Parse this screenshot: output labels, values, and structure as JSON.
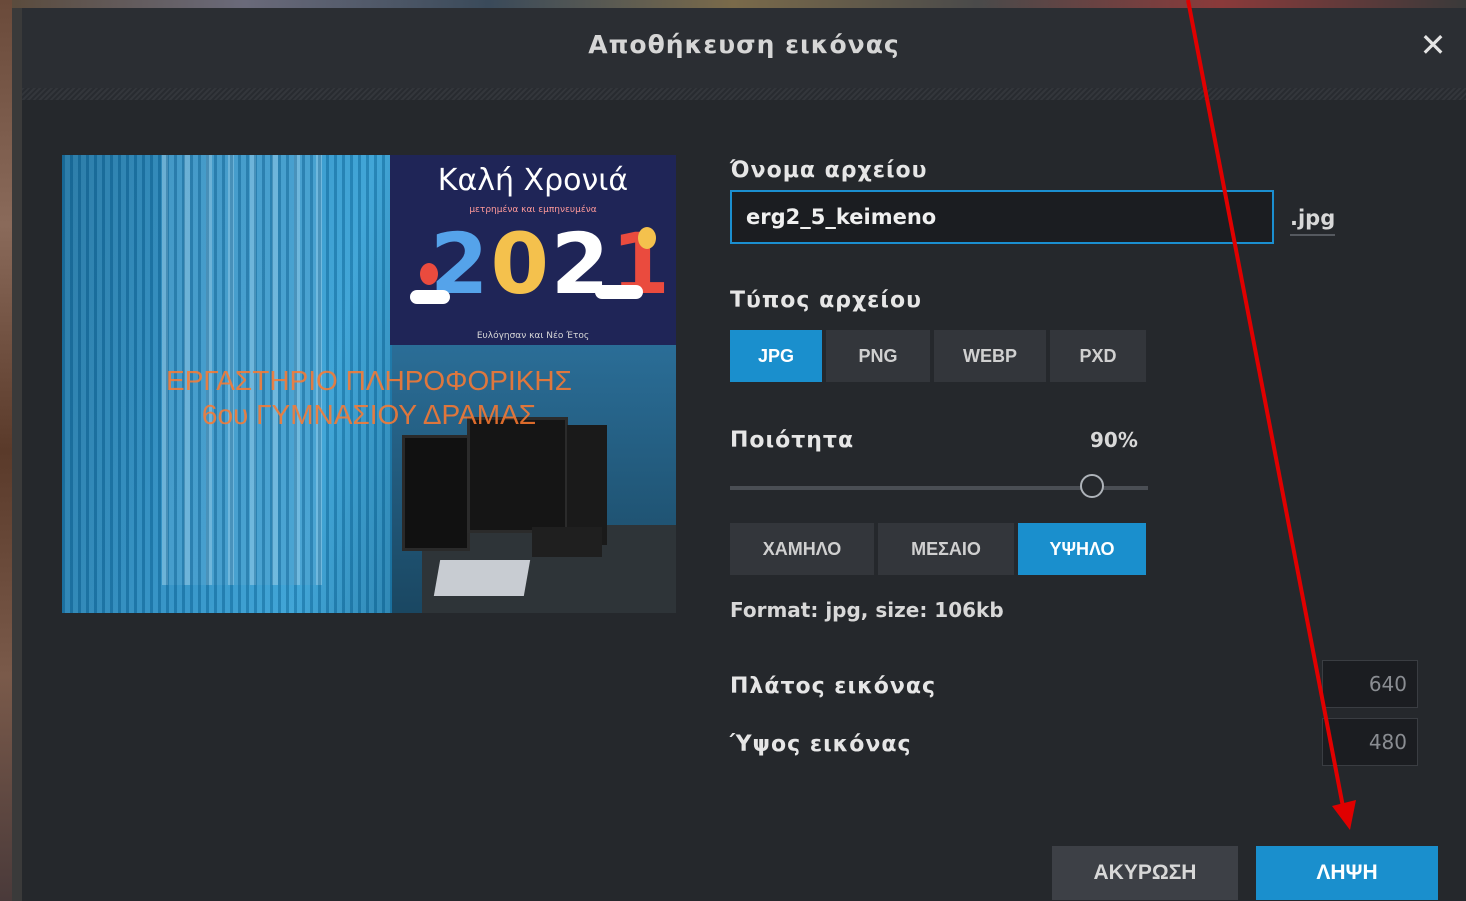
{
  "dialog": {
    "title": "Αποθήκευση εικόνας",
    "close_icon": "close-icon"
  },
  "preview": {
    "card_title": "Καλή Χρονιά",
    "card_subtitle": "μετρημένα και εμπηνευμένα",
    "year_digits": [
      "2",
      "0",
      "2",
      "1"
    ],
    "card_footer": "Ευλόγησαν και Νέο Έτος",
    "overlay_line1": "ΕΡΓΑΣΤΗΡΙΟ ΠΛΗΡΟΦΟΡΙΚΗΣ",
    "overlay_line2": "6ου ΓΥΜΝΑΣΙΟΥ ΔΡΑΜΑΣ"
  },
  "form": {
    "filename_label": "Όνομα αρχείου",
    "filename_value": "erg2_5_keimeno",
    "extension": ".jpg",
    "filetype_label": "Τύπος αρχείου",
    "filetypes": [
      "JPG",
      "PNG",
      "WEBP",
      "PXD"
    ],
    "filetype_selected": "JPG",
    "quality_label": "Ποιότητα",
    "quality_value": "90%",
    "quality_fraction": 0.9,
    "quality_presets": [
      "ΧΑΜΗΛΟ",
      "ΜΕΣΑΙΟ",
      "ΥΨΗΛΟ"
    ],
    "quality_preset_selected": "ΥΨΗΛΟ",
    "format_info": "Format: jpg, size: 106kb",
    "width_label": "Πλάτος εικόνας",
    "width_value": "640",
    "height_label": "Ύψος εικόνας",
    "height_value": "480"
  },
  "buttons": {
    "cancel": "ΑΚΥΡΩΣΗ",
    "download": "ΛΗΨΗ"
  },
  "colors": {
    "accent": "#1a8fcd",
    "dialog_bg": "#25282c",
    "annotation_arrow": "#e00000"
  }
}
